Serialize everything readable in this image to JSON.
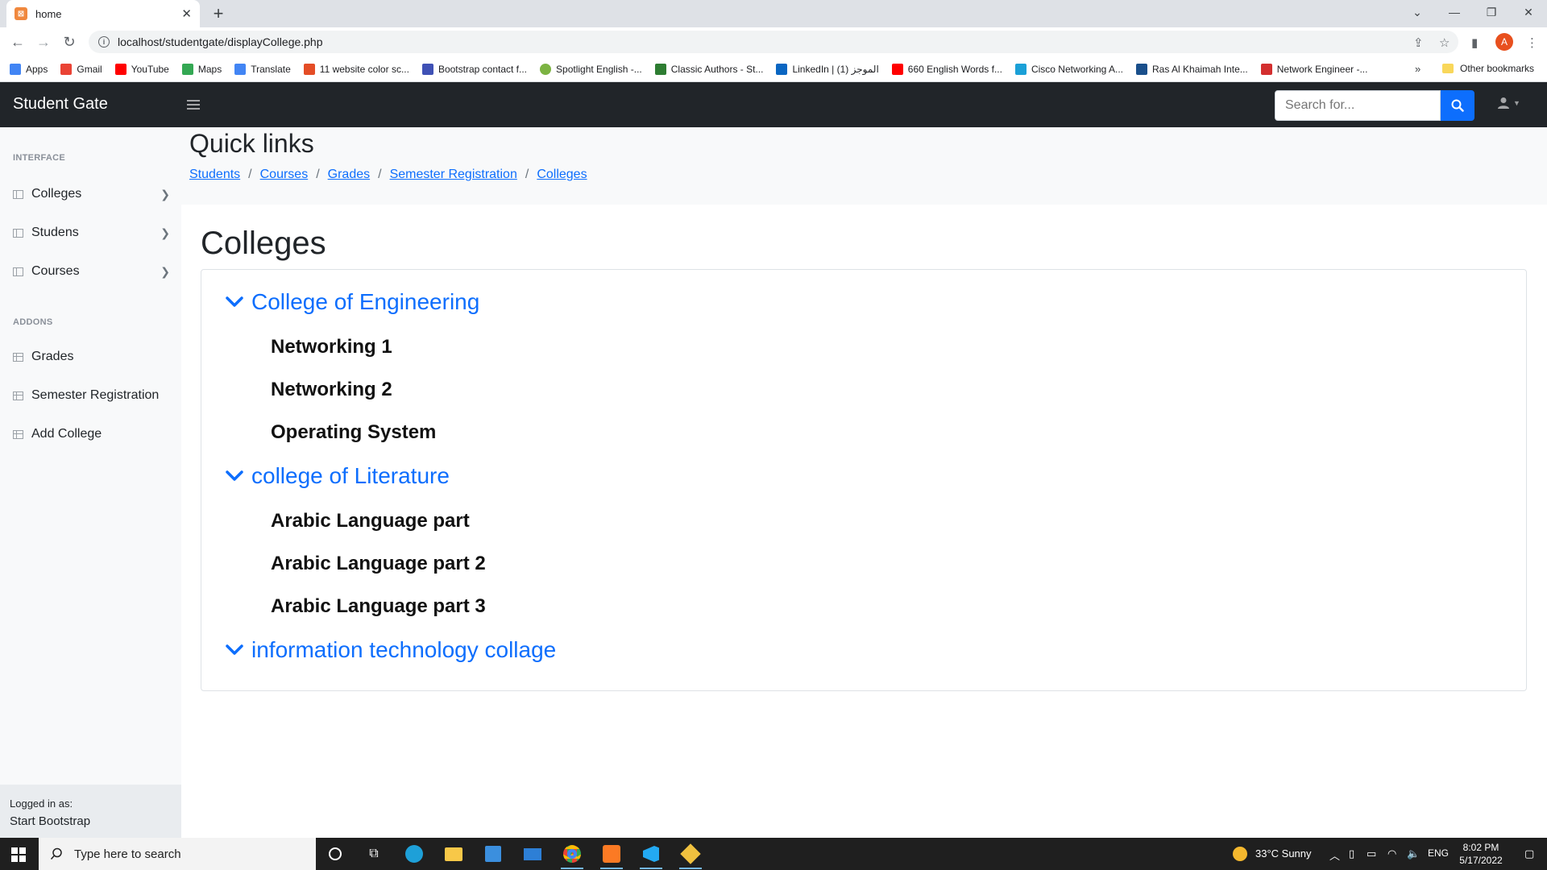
{
  "browser": {
    "tab_title": "home",
    "url": "localhost/studentgate/displayCollege.php",
    "profile_initial": "A",
    "bookmarks": [
      {
        "label": "Apps",
        "color": "#4285f4"
      },
      {
        "label": "Gmail",
        "color": "#ea4335"
      },
      {
        "label": "YouTube",
        "color": "#ff0000"
      },
      {
        "label": "Maps",
        "color": "#34a853"
      },
      {
        "label": "Translate",
        "color": "#4285f4"
      },
      {
        "label": "11 website color sc...",
        "color": "#e44d26"
      },
      {
        "label": "Bootstrap contact f...",
        "color": "#3f51b5"
      },
      {
        "label": "Spotlight English -...",
        "color": "#7cb342"
      },
      {
        "label": "Classic Authors - St...",
        "color": "#2e7d32"
      },
      {
        "label": "LinkedIn | الموجز (1)",
        "color": "#0a66c2"
      },
      {
        "label": "660 English Words f...",
        "color": "#ff0000"
      },
      {
        "label": "Cisco Networking A...",
        "color": "#1ba0d7"
      },
      {
        "label": "Ras Al Khaimah Inte...",
        "color": "#1a4f8b"
      },
      {
        "label": "Network Engineer -...",
        "color": "#d32f2f"
      }
    ],
    "more": "»",
    "other_bookmarks": "Other bookmarks"
  },
  "navbar": {
    "brand": "Student Gate",
    "search_placeholder": "Search for..."
  },
  "sidebar": {
    "heading_interface": "INTERFACE",
    "interface_items": [
      {
        "label": "Colleges"
      },
      {
        "label": "Studens"
      },
      {
        "label": "Courses"
      }
    ],
    "heading_addons": "ADDONS",
    "addon_items": [
      {
        "label": "Grades"
      },
      {
        "label": "Semester Registration"
      },
      {
        "label": "Add College"
      }
    ],
    "footer_small": "Logged in as:",
    "footer_name": "Start Bootstrap"
  },
  "quick_links": {
    "title": "Quick links",
    "crumbs": [
      "Students",
      "Courses",
      "Grades",
      "Semester Registration",
      "Colleges"
    ],
    "separator": "/"
  },
  "main": {
    "title": "Colleges",
    "colleges": [
      {
        "name": "College of Engineering",
        "courses": [
          "Networking 1",
          "Networking 2",
          "Operating System"
        ]
      },
      {
        "name": "college of Literature",
        "courses": [
          "Arabic Language part",
          "Arabic Language part 2",
          "Arabic Language part 3"
        ]
      },
      {
        "name": "information technology collage",
        "courses": []
      }
    ]
  },
  "taskbar": {
    "search_placeholder": "Type here to search",
    "weather": "33°C  Sunny",
    "language": "ENG",
    "time": "8:02 PM",
    "date": "5/17/2022"
  }
}
